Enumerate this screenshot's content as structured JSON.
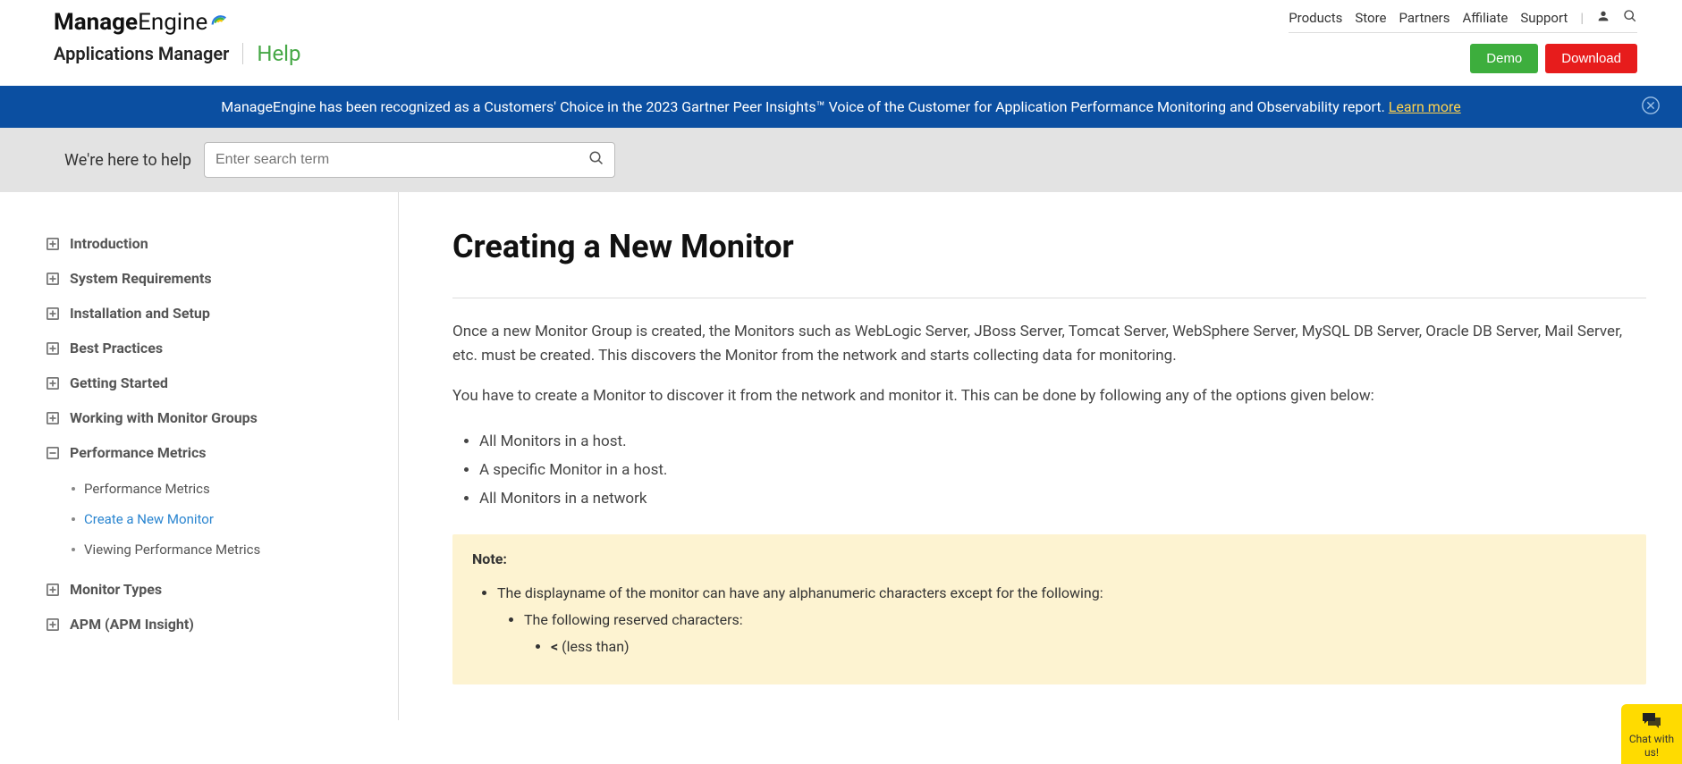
{
  "header": {
    "brand_prefix": "Manage",
    "brand_suffix": "Engine",
    "product": "Applications Manager",
    "help_label": "Help",
    "nav": [
      "Products",
      "Store",
      "Partners",
      "Affiliate",
      "Support"
    ],
    "demo_label": "Demo",
    "download_label": "Download"
  },
  "banner": {
    "text": "ManageEngine has been recognized as a Customers' Choice in the 2023 Gartner Peer Insights™ Voice of the Customer for Application Performance Monitoring and Observability report. ",
    "link_text": "Learn more"
  },
  "search": {
    "help_text": "We're here to help",
    "placeholder": "Enter search term"
  },
  "sidebar": {
    "items": [
      {
        "label": "Introduction",
        "type": "plus"
      },
      {
        "label": "System Requirements",
        "type": "plus"
      },
      {
        "label": "Installation and Setup",
        "type": "plus"
      },
      {
        "label": "Best Practices",
        "type": "plus"
      },
      {
        "label": "Getting Started",
        "type": "plus"
      },
      {
        "label": "Working with Monitor Groups",
        "type": "plus"
      },
      {
        "label": "Performance Metrics",
        "type": "minus"
      },
      {
        "label": "Monitor Types",
        "type": "plus"
      },
      {
        "label": "APM (APM Insight)",
        "type": "plus"
      }
    ],
    "sub_items": [
      {
        "label": "Performance Metrics",
        "active": false
      },
      {
        "label": "Create a New Monitor",
        "active": true
      },
      {
        "label": "Viewing Performance Metrics",
        "active": false
      }
    ]
  },
  "content": {
    "title": "Creating a New Monitor",
    "para1": "Once a new Monitor Group is created, the Monitors such as WebLogic Server, JBoss Server, Tomcat Server, WebSphere Server, MySQL DB Server, Oracle DB Server, Mail Server, etc. must be created. This discovers the Monitor from the network and starts collecting data for monitoring.",
    "para2": "You have to create a Monitor to discover it from the network and monitor it. This can be done by following any of the options given below:",
    "options": [
      "All Monitors in a host.",
      "A specific Monitor in a host.",
      "All Monitors in a network"
    ],
    "note_title": "Note:",
    "note_l1": "The displayname of the monitor can have any alphanumeric characters except for the following:",
    "note_l2": "The following reserved characters:",
    "note_l3": "< (less than)"
  },
  "chat": {
    "line1": "Chat with",
    "line2": "us!"
  }
}
